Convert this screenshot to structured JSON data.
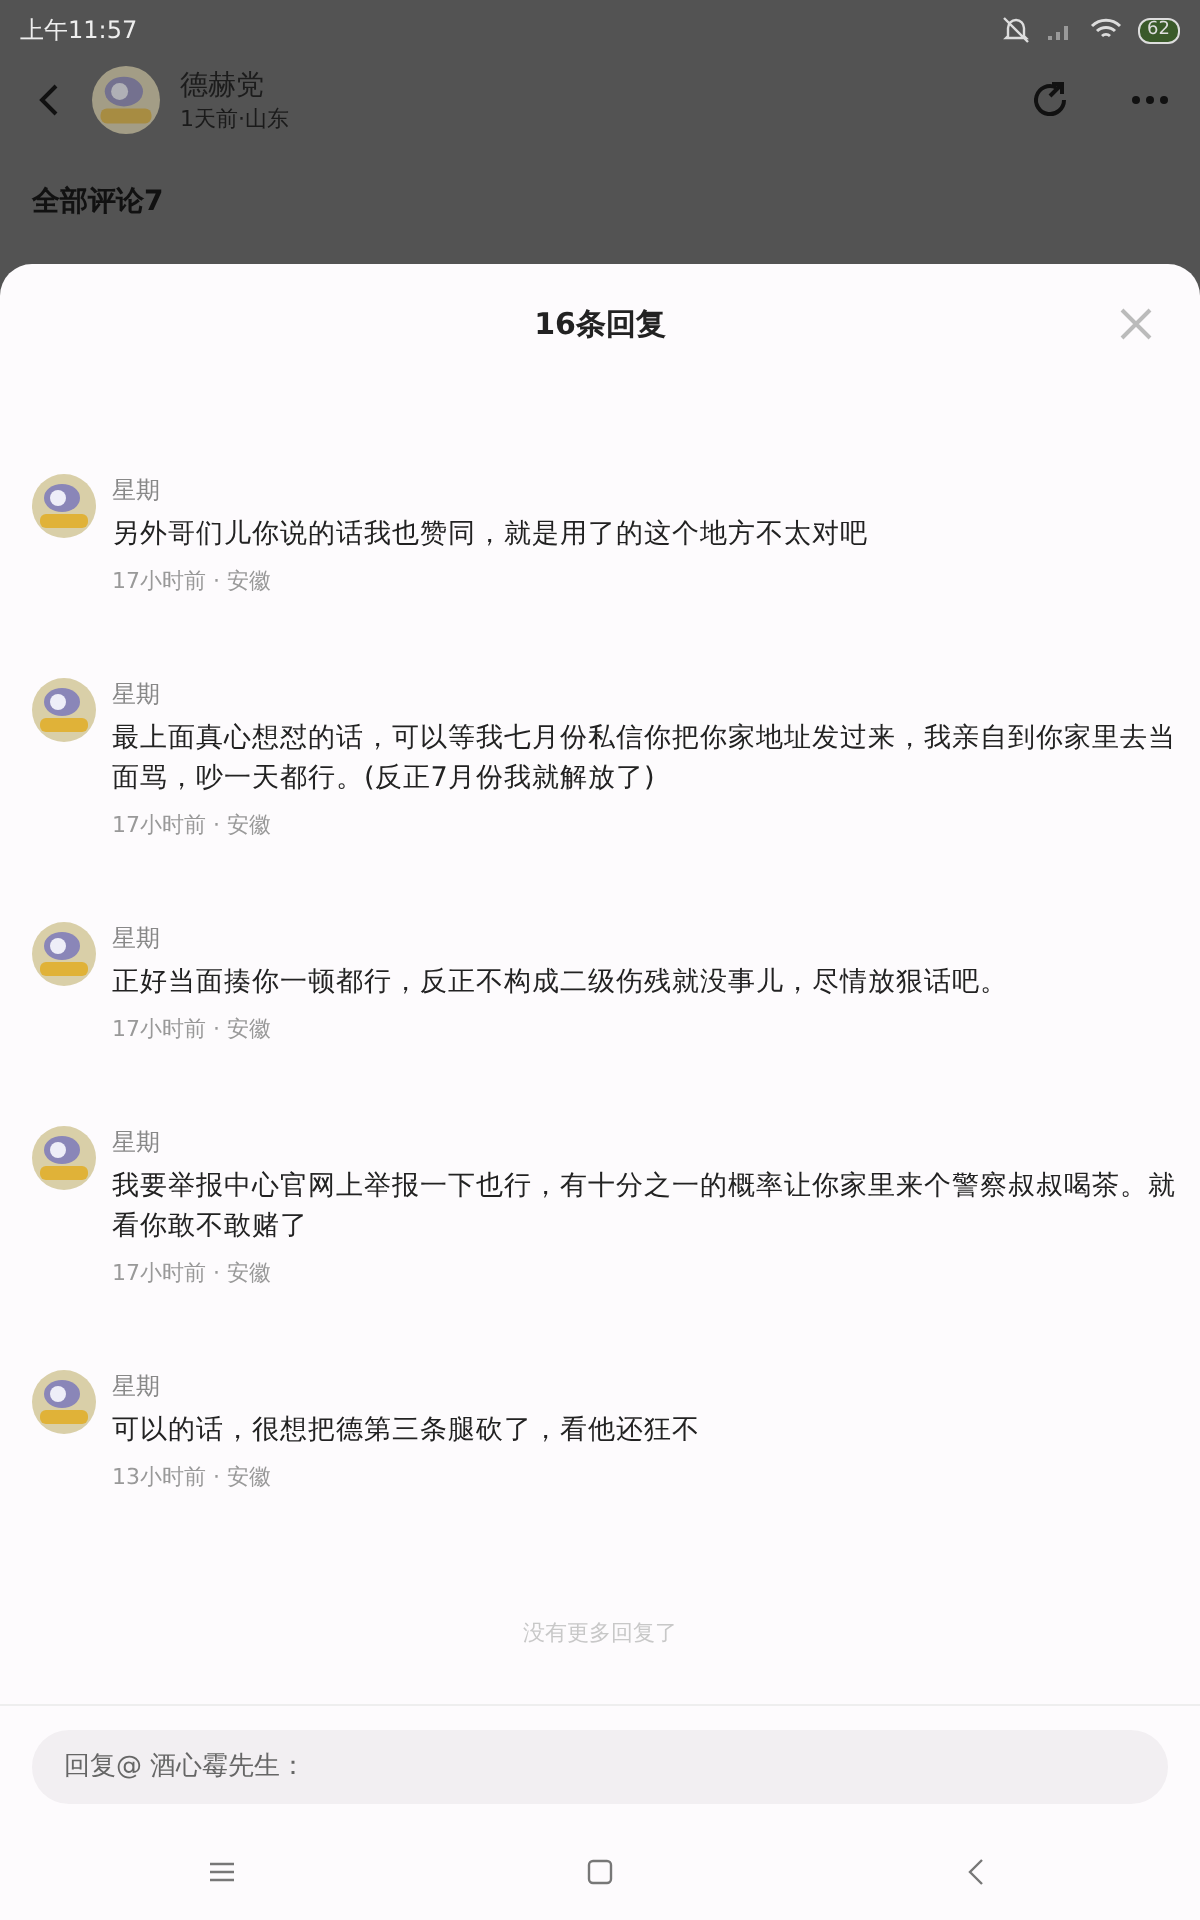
{
  "status_bar": {
    "time": "上午11:57",
    "battery": "62"
  },
  "header": {
    "title": "德赫党",
    "subtitle": "1天前·山东"
  },
  "section_title": "全部评论7",
  "sheet": {
    "title": "16条回复",
    "replies": [
      {
        "name": "星期",
        "text": "另外哥们儿你说的话我也赞同，就是用了的这个地方不太对吧",
        "meta": "17小时前 · 安徽"
      },
      {
        "name": "星期",
        "text": "最上面真心想怼的话，可以等我七月份私信你把你家地址发过来，我亲自到你家里去当面骂，吵一天都行。(反正7月份我就解放了)",
        "meta": "17小时前 · 安徽"
      },
      {
        "name": "星期",
        "text": "正好当面揍你一顿都行，反正不构成二级伤残就没事儿，尽情放狠话吧。",
        "meta": "17小时前 · 安徽"
      },
      {
        "name": "星期",
        "text": "我要举报中心官网上举报一下也行，有十分之一的概率让你家里来个警察叔叔喝茶。就看你敢不敢赌了",
        "meta": "17小时前 · 安徽"
      },
      {
        "name": "星期",
        "text": "可以的话，很想把德第三条腿砍了，看他还狂不",
        "meta": "13小时前 · 安徽"
      }
    ],
    "end_note": "没有更多回复了",
    "reply_field": {
      "placeholder": "回复@ 酒心霉先生："
    }
  }
}
